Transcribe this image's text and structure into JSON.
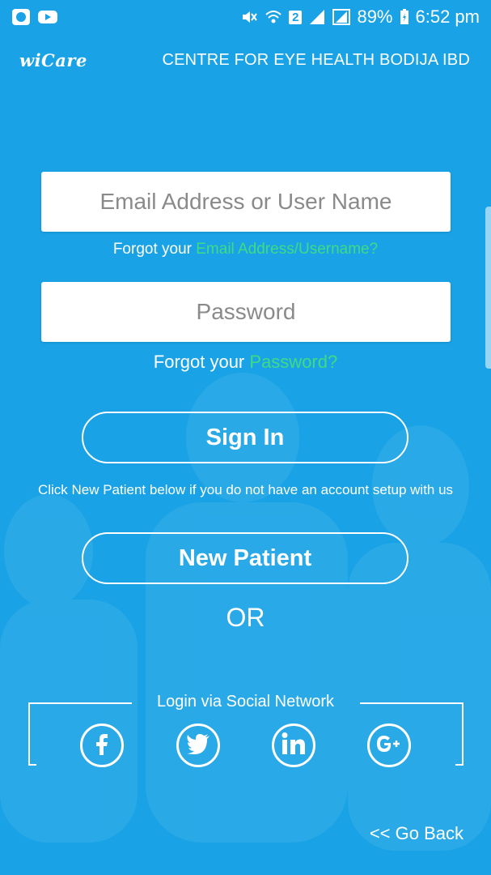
{
  "status_bar": {
    "battery": "89%",
    "time": "6:52 pm",
    "sim_badge": "2",
    "icons": [
      "app-icon",
      "youtube-icon",
      "mute-icon",
      "wifi-icon",
      "signal-icon",
      "signal-icon",
      "battery-charging-icon"
    ]
  },
  "header": {
    "logo": "wiCare",
    "title": "CENTRE FOR EYE HEALTH BODIJA IBD"
  },
  "login": {
    "username_placeholder": "Email Address or User Name",
    "forgot_username_prefix": "Forgot your",
    "forgot_username_link": "Email Address/Username?",
    "password_placeholder": "Password",
    "forgot_password_prefix": "Forgot your",
    "forgot_password_link": "Password?",
    "sign_in_label": "Sign In",
    "help_text": "Click New Patient below if you do not have an account setup with us",
    "new_patient_label": "New Patient",
    "or_label": "OR"
  },
  "social": {
    "title": "Login via Social Network",
    "buttons": [
      {
        "icon": "facebook-icon",
        "glyph": "f"
      },
      {
        "icon": "twitter-icon",
        "glyph": ""
      },
      {
        "icon": "linkedin-icon",
        "glyph": "in"
      },
      {
        "icon": "google-plus-icon",
        "glyph": "G+"
      }
    ]
  },
  "footer": {
    "go_back_label": "<< Go Back"
  },
  "colors": {
    "background": "#19a3e6",
    "link": "#3ddc84",
    "input_bg": "#ffffff",
    "placeholder": "#8a8a8a"
  }
}
